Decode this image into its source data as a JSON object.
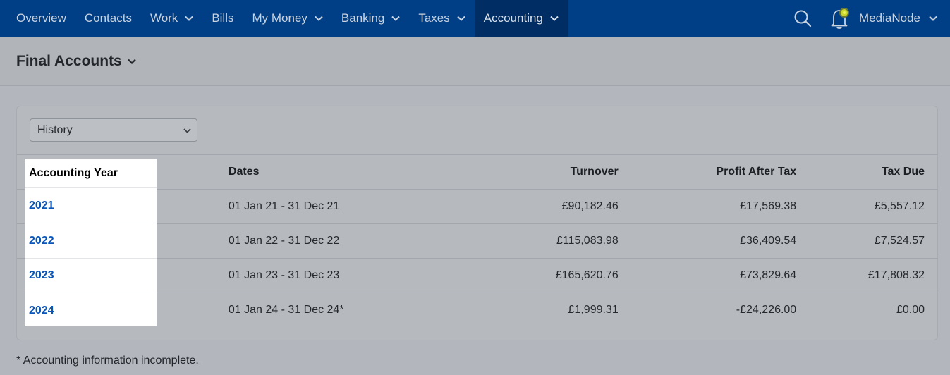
{
  "nav": {
    "items": [
      {
        "label": "Overview",
        "has_dropdown": false,
        "active": false
      },
      {
        "label": "Contacts",
        "has_dropdown": false,
        "active": false
      },
      {
        "label": "Work",
        "has_dropdown": true,
        "active": false
      },
      {
        "label": "Bills",
        "has_dropdown": false,
        "active": false
      },
      {
        "label": "My Money",
        "has_dropdown": true,
        "active": false
      },
      {
        "label": "Banking",
        "has_dropdown": true,
        "active": false
      },
      {
        "label": "Taxes",
        "has_dropdown": true,
        "active": false
      },
      {
        "label": "Accounting",
        "has_dropdown": true,
        "active": true
      }
    ],
    "user": "MediaNode",
    "icons": {
      "search": "search-icon",
      "notifications": "bell-icon"
    }
  },
  "page": {
    "title": "Final Accounts"
  },
  "filter": {
    "selected": "History"
  },
  "table": {
    "headers": {
      "year": "Accounting Year",
      "dates": "Dates",
      "turnover": "Turnover",
      "profit": "Profit After Tax",
      "tax": "Tax Due"
    },
    "rows": [
      {
        "year": "2021",
        "dates": "01 Jan 21 - 31 Dec 21",
        "turnover": "£90,182.46",
        "profit": "£17,569.38",
        "tax": "£5,557.12"
      },
      {
        "year": "2022",
        "dates": "01 Jan 22 - 31 Dec 22",
        "turnover": "£115,083.98",
        "profit": "£36,409.54",
        "tax": "£7,524.57"
      },
      {
        "year": "2023",
        "dates": "01 Jan 23 - 31 Dec 23",
        "turnover": "£165,620.76",
        "profit": "£73,829.64",
        "tax": "£17,808.32"
      },
      {
        "year": "2024",
        "dates": "01 Jan 24 - 31 Dec 24*",
        "turnover": "£1,999.31",
        "profit": "-£24,226.00",
        "tax": "£0.00"
      }
    ]
  },
  "footnote": "* Accounting information incomplete.",
  "colors": {
    "nav_bg": "#003f85",
    "nav_active_bg": "#002d63",
    "link": "#0a55b7",
    "bell_accent": "#c9d62a"
  }
}
